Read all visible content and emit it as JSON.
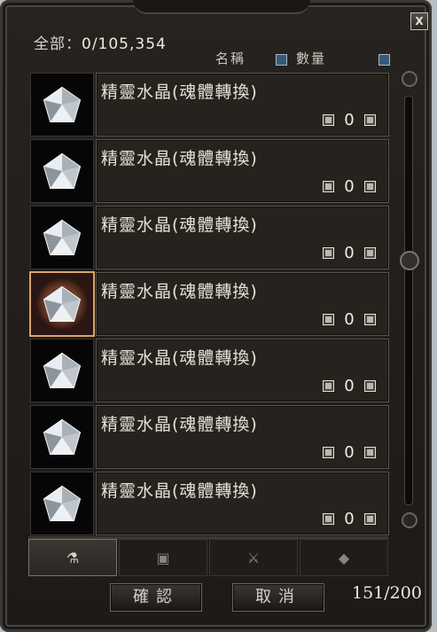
{
  "header": {
    "total_label": "全部：",
    "total_value": "0/105,354",
    "sort_name_label": "名稱",
    "sort_qty_label": "數量",
    "close_label": "X"
  },
  "items": [
    {
      "name": "精靈水晶(魂體轉換)",
      "quantity": "0",
      "selected": false
    },
    {
      "name": "精靈水晶(魂體轉換)",
      "quantity": "0",
      "selected": false
    },
    {
      "name": "精靈水晶(魂體轉換)",
      "quantity": "0",
      "selected": false
    },
    {
      "name": "精靈水晶(魂體轉換)",
      "quantity": "0",
      "selected": true
    },
    {
      "name": "精靈水晶(魂體轉換)",
      "quantity": "0",
      "selected": false
    },
    {
      "name": "精靈水晶(魂體轉換)",
      "quantity": "0",
      "selected": false
    },
    {
      "name": "精靈水晶(魂體轉換)",
      "quantity": "0",
      "selected": false
    }
  ],
  "tabs": [
    {
      "icon": "potion-icon",
      "active": true
    },
    {
      "icon": "armor-icon",
      "active": false
    },
    {
      "icon": "weapon-icon",
      "active": false
    },
    {
      "icon": "material-icon",
      "active": false
    }
  ],
  "footer": {
    "confirm_label": "確認",
    "cancel_label": "取消",
    "capacity": "151/200"
  },
  "colors": {
    "panel_bg": "#1f1c19",
    "text": "#e6e0d6",
    "selected_border": "#d7a56a",
    "sort_arrow": "#365a7a"
  }
}
